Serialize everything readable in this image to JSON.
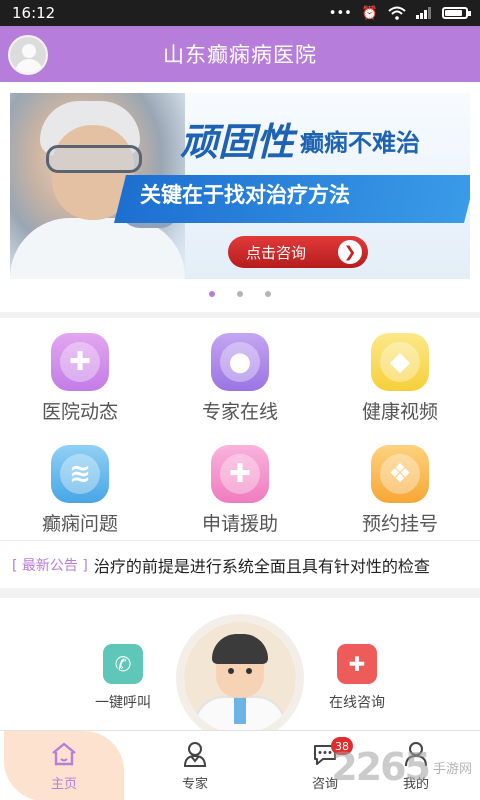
{
  "statusbar": {
    "time": "16:12",
    "dots": "•••",
    "alarm": "⏰",
    "wifi": "WiFi",
    "signal": "▮▮▮",
    "battery_level": 0.85
  },
  "appbar": {
    "title": "山东癫痫病医院"
  },
  "banner": {
    "headline_big": "顽固性",
    "headline_small": "癫痫不难治",
    "subline": "关键在于找对治疗方法",
    "button_label": "点击咨询",
    "button_arrow": "❯",
    "dots": 3,
    "active_dot": 0
  },
  "menu": {
    "items": [
      {
        "label": "医院动态",
        "icon": "plus-circle-icon",
        "color_top": "#e3a6f0",
        "color_bottom": "#c37ce6",
        "glyph": "✚"
      },
      {
        "label": "专家在线",
        "icon": "group-icon",
        "color_top": "#c4a5f2",
        "color_bottom": "#9b74e3",
        "glyph": "●"
      },
      {
        "label": "健康视频",
        "icon": "video-icon",
        "color_top": "#fbe88a",
        "color_bottom": "#f6cf39",
        "glyph": "◆"
      },
      {
        "label": "癫痫问题",
        "icon": "layers-icon",
        "color_top": "#8fd0f5",
        "color_bottom": "#48a6e6",
        "glyph": "≋"
      },
      {
        "label": "申请援助",
        "icon": "medical-kit-icon",
        "color_top": "#f9b2dc",
        "color_bottom": "#f07cbf",
        "glyph": "✚"
      },
      {
        "label": "预约挂号",
        "icon": "appointment-icon",
        "color_top": "#fdd27e",
        "color_bottom": "#f7a735",
        "glyph": "❖"
      }
    ]
  },
  "notice": {
    "tag": "[ 最新公告 ]",
    "text": "治疗的前提是进行系统全面且具有针对性的检查"
  },
  "quick_actions": {
    "call_label": "一键呼叫",
    "call_color": "#5fc7b8",
    "call_glyph": "✆",
    "consult_label": "在线咨询",
    "consult_color": "#ee5b5b",
    "consult_glyph": "✚"
  },
  "tabbar": {
    "tabs": [
      {
        "label": "主页",
        "icon": "home-icon"
      },
      {
        "label": "专家",
        "icon": "expert-icon"
      },
      {
        "label": "咨询",
        "icon": "chat-icon",
        "badge": "38"
      },
      {
        "label": "我的",
        "icon": "user-icon"
      }
    ]
  },
  "watermark": {
    "number": "2265",
    "text": "手游网"
  },
  "colors": {
    "accent": "#b67ddb",
    "active_tab_bg": "#fde3cf",
    "badge": "#e12c2c"
  }
}
